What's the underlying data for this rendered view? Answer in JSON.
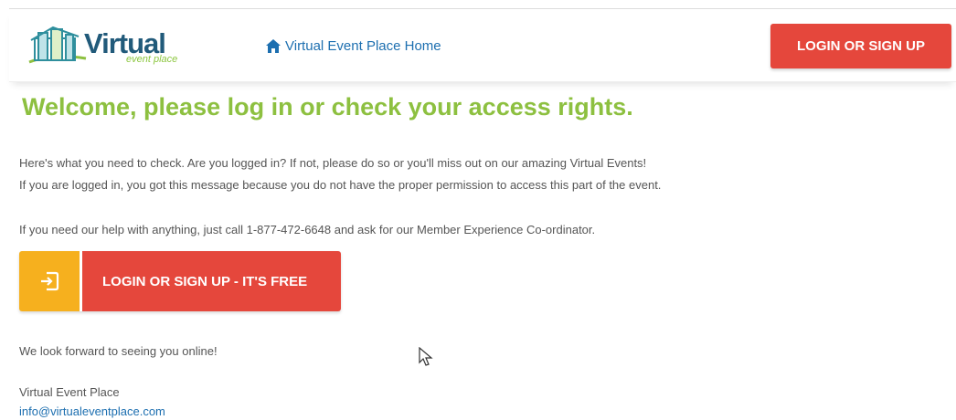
{
  "header": {
    "logo": {
      "word": "Virtual",
      "sub": "event place"
    },
    "home_link": "Virtual Event Place Home",
    "login_button": "LOGIN OR SIGN UP"
  },
  "main": {
    "title": "Welcome, please log in or check your access rights.",
    "paragraph1": "Here's what you need to check. Are you logged in? If not, please do so or you'll miss out on our amazing Virtual Events!",
    "paragraph2": "If you are logged in, you got this message because you do not have the proper permission to access this part of the event.",
    "paragraph3": "If you need our help with anything, just call 1-877-472-6648 and ask for our Member Experience Co-ordinator.",
    "cta_label": "LOGIN OR SIGN UP - IT'S FREE",
    "closing": "We look forward to seeing you online!",
    "signature_name": "Virtual Event Place",
    "signature_email": "info@virtualeventplace.com"
  },
  "colors": {
    "brand_green": "#8dc040",
    "button_red": "#e5473c",
    "icon_yellow": "#f6b01e",
    "link_blue": "#1d6fb0"
  },
  "icons": {
    "home": "home-icon",
    "login": "sign-in-icon",
    "cursor": "mouse-pointer-icon"
  }
}
